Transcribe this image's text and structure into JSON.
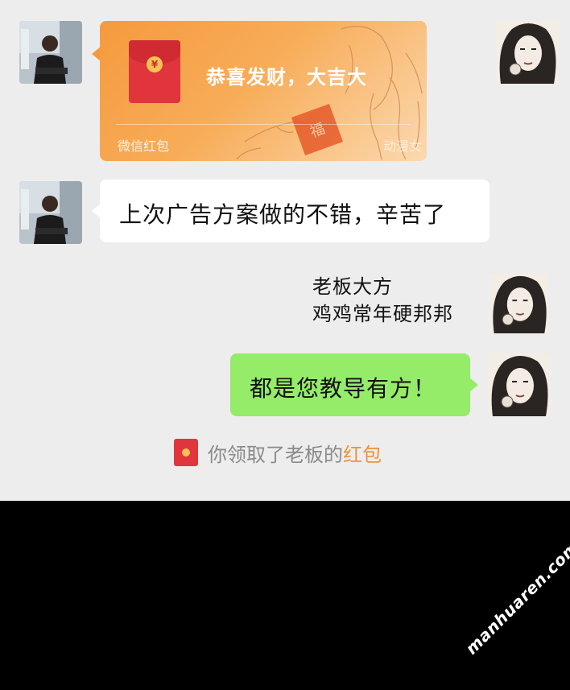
{
  "messages": [
    {
      "type": "red_packet",
      "sender": "boss",
      "title": "恭喜发财，大吉大",
      "footer": "微信红包",
      "footer_right": "动漫女",
      "coin": "¥"
    },
    {
      "type": "text",
      "sender": "boss",
      "text": "上次广告方案做的不错，辛苦了"
    },
    {
      "type": "narration",
      "sender": "me",
      "lines": [
        "老板大方",
        "鸡鸡常年硬邦邦"
      ]
    },
    {
      "type": "text",
      "sender": "me",
      "text": "都是您教导有方！"
    }
  ],
  "system_notice": {
    "prefix": "你领取了老板的",
    "link": "红包"
  },
  "watermark": "manhuaren.com",
  "colors": {
    "chat_bg": "#ededed",
    "my_bubble": "#95ec69",
    "their_bubble": "#ffffff",
    "red_packet": "#f59a3e",
    "link": "#e8943a"
  },
  "icons": [
    "boss-avatar",
    "girl-avatar",
    "red-packet-icon",
    "coin-icon"
  ]
}
